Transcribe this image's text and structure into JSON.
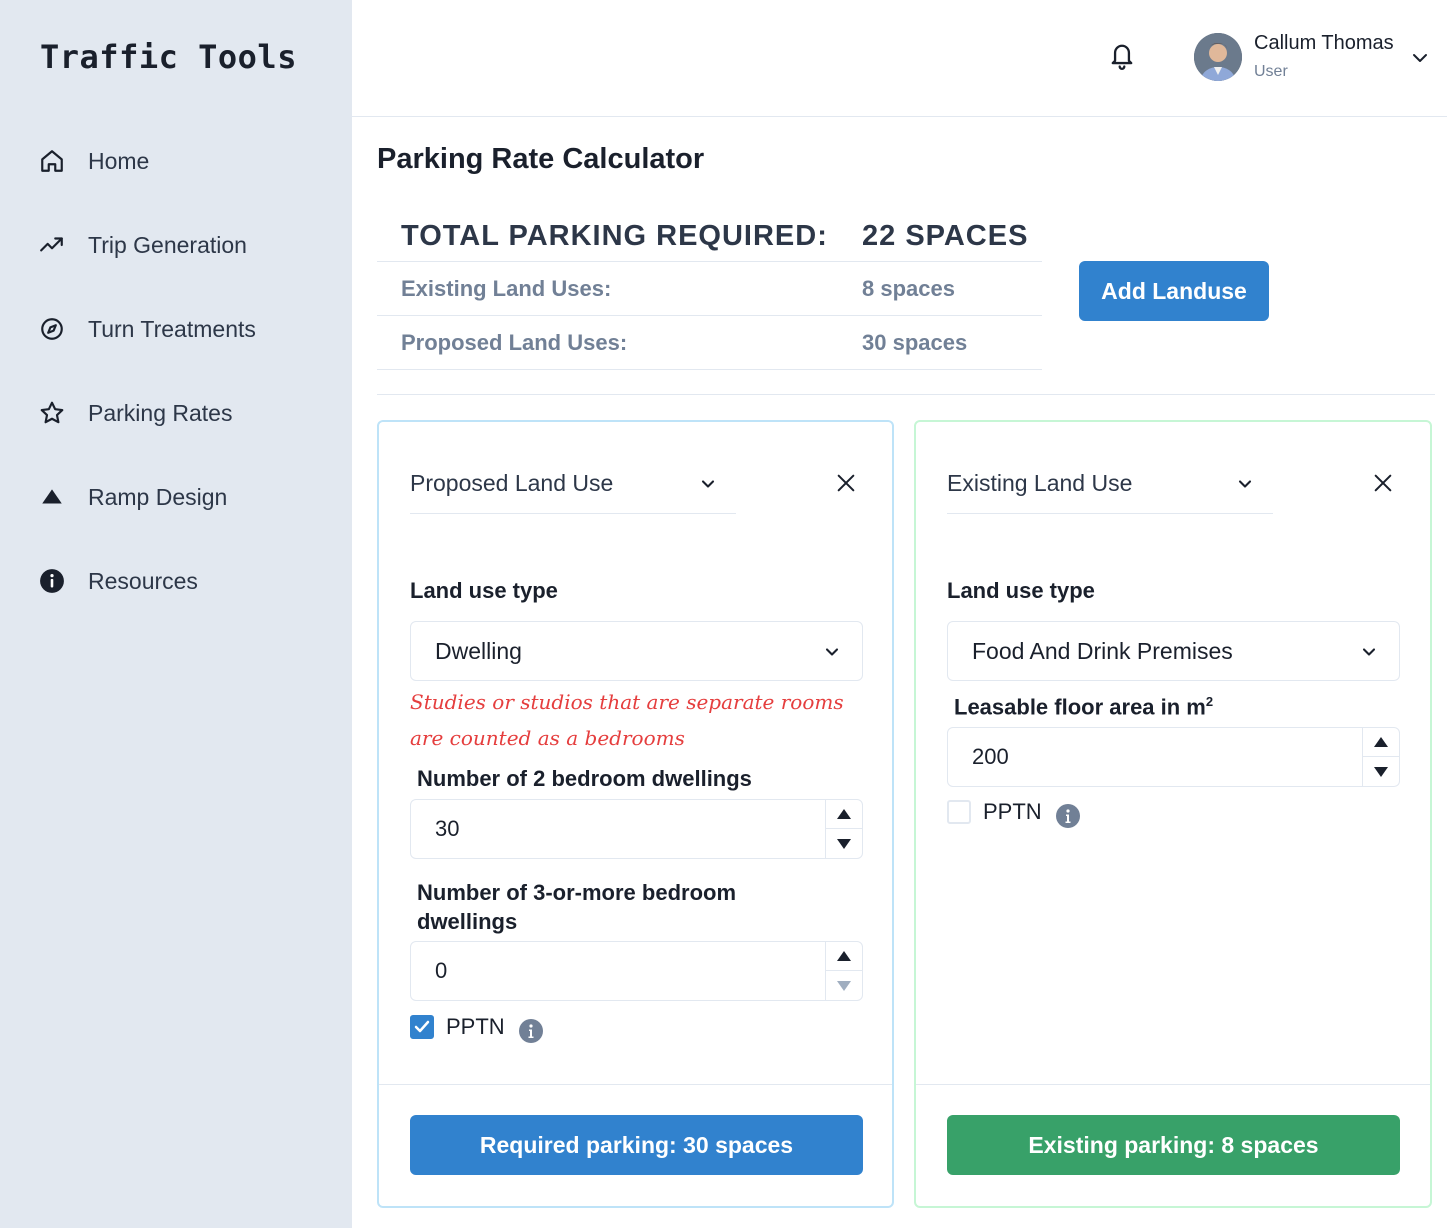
{
  "app": {
    "title": "Traffic Tools"
  },
  "sidebar": {
    "items": [
      {
        "label": "Home",
        "icon": "home-icon"
      },
      {
        "label": "Trip Generation",
        "icon": "trending-up-icon"
      },
      {
        "label": "Turn Treatments",
        "icon": "compass-icon"
      },
      {
        "label": "Parking Rates",
        "icon": "star-icon"
      },
      {
        "label": "Ramp Design",
        "icon": "triangle-up-icon"
      },
      {
        "label": "Resources",
        "icon": "info-circle-icon"
      }
    ]
  },
  "header": {
    "user_name": "Callum Thomas",
    "user_role": "User"
  },
  "page": {
    "title": "Parking Rate Calculator",
    "summary": {
      "total_label": "TOTAL PARKING REQUIRED:",
      "total_value": "22 SPACES",
      "existing_label": "Existing Land Uses:",
      "existing_value": "8 spaces",
      "proposed_label": "Proposed Land Uses:",
      "proposed_value": "30 spaces"
    },
    "add_button": "Add Landuse"
  },
  "cards": {
    "proposed": {
      "category": "Proposed Land Use",
      "land_use_label": "Land use type",
      "land_use_value": "Dwelling",
      "note": "Studies or studios that are separate rooms are counted as a bedrooms",
      "field1_label": "Number of 2 bedroom dwellings",
      "field1_value": "30",
      "field2_label_line1": "Number of 3-or-more bedroom",
      "field2_label_line2": "dwellings",
      "field2_value": "0",
      "pptn_label": "PPTN",
      "pptn_checked": true,
      "result": "Required parking: 30 spaces"
    },
    "existing": {
      "category": "Existing Land Use",
      "land_use_label": "Land use type",
      "land_use_value": "Food And Drink Premises",
      "field1_label": "Leasable floor area in m",
      "field1_sup": "2",
      "field1_value": "200",
      "pptn_label": "PPTN",
      "pptn_checked": false,
      "result": "Existing parking: 8 spaces"
    }
  },
  "colors": {
    "sidebar_bg": "#e2e8f0",
    "primary": "#3182ce",
    "success": "#38a169",
    "note_red": "#e53e3e",
    "proposed_border": "#bee3f8",
    "existing_border": "#c6f6d5"
  }
}
